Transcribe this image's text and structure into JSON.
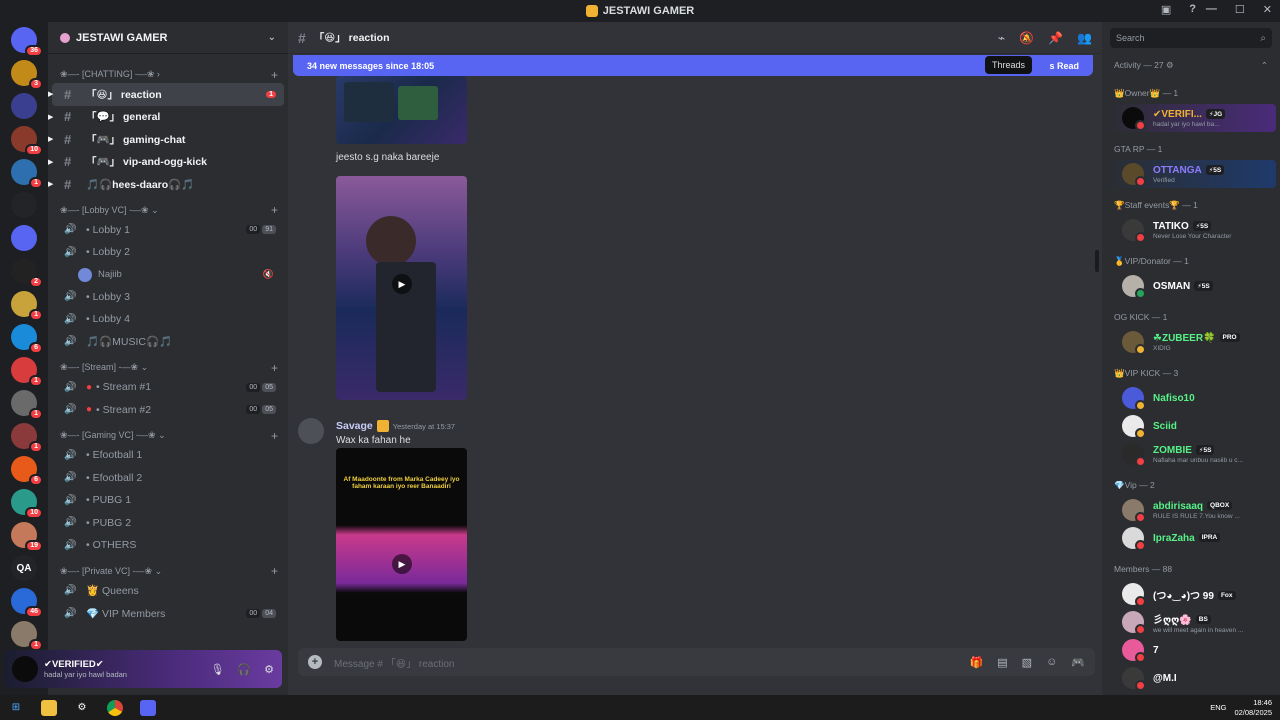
{
  "window": {
    "title": "JESTAWI GAMER"
  },
  "rail": {
    "servers": [
      {
        "label": "",
        "badge": "36",
        "color": "#5865f2"
      },
      {
        "label": "",
        "badge": "3",
        "color": "#c28a18"
      },
      {
        "label": "",
        "badge": "",
        "color": "#3b3f8f"
      },
      {
        "label": "",
        "badge": "10",
        "color": "#8a3a2a"
      },
      {
        "label": "",
        "badge": "1",
        "color": "#2e6fb0"
      },
      {
        "label": "",
        "badge": "",
        "color": "#232428"
      },
      {
        "label": "",
        "badge": "",
        "color": "#5865f2"
      },
      {
        "label": "",
        "badge": "2",
        "color": "#222"
      },
      {
        "label": "",
        "badge": "1",
        "color": "#c8a23a"
      },
      {
        "label": "",
        "badge": "6",
        "color": "#1a8bd8"
      },
      {
        "label": "",
        "badge": "1",
        "color": "#d83c3c"
      },
      {
        "label": "",
        "badge": "1",
        "color": "#6a6a6a"
      },
      {
        "label": "",
        "badge": "1",
        "color": "#8a3a3a"
      },
      {
        "label": "",
        "badge": "6",
        "color": "#e85a1a"
      },
      {
        "label": "",
        "badge": "10",
        "color": "#2a9a8a"
      },
      {
        "label": "",
        "badge": "19",
        "color": "#c47a5a"
      },
      {
        "label": "QA",
        "badge": "",
        "color": "#232428"
      },
      {
        "label": "",
        "badge": "46",
        "color": "#2a6ad8"
      },
      {
        "label": "",
        "badge": "1",
        "color": "#8a7a6a"
      }
    ],
    "new_label": "NEW"
  },
  "sidebar": {
    "guild_name": "JESTAWI GAMER",
    "categories": [
      {
        "name": "❀—- [CHATTING] -—❀ ›",
        "channels": [
          {
            "type": "text",
            "name": "「😆」 reaction",
            "state": "active",
            "badge": "1"
          },
          {
            "type": "text",
            "name": "「💬」 general",
            "state": "unread"
          },
          {
            "type": "text",
            "name": "「🎮」 gaming-chat",
            "state": "unread"
          },
          {
            "type": "text",
            "name": "「🎮」 vip-and-ogg-kick",
            "state": "unread"
          },
          {
            "type": "text",
            "name": "🎵🎧hees-daaro🎧🎵",
            "state": "unread"
          }
        ]
      },
      {
        "name": "❀—- [Lobby VC] -—❀ ⌄",
        "channels": [
          {
            "type": "voice",
            "name": "• Lobby 1",
            "counts": [
              "00",
              "91"
            ]
          },
          {
            "type": "voice",
            "name": "• Lobby 2",
            "users": [
              {
                "name": "Najiib"
              }
            ]
          },
          {
            "type": "voice",
            "name": "• Lobby 3"
          },
          {
            "type": "voice",
            "name": "• Lobby 4"
          },
          {
            "type": "voice",
            "name": "🎵🎧MUSIC🎧🎵"
          }
        ]
      },
      {
        "name": "❀—- [Stream] -—❀ ⌄",
        "channels": [
          {
            "type": "voice",
            "name": "• Stream #1",
            "dot": true,
            "counts": [
              "00",
              "05"
            ]
          },
          {
            "type": "voice",
            "name": "• Stream #2",
            "dot": true,
            "counts": [
              "00",
              "05"
            ]
          }
        ]
      },
      {
        "name": "❀—- [Gaming VC] -—❀ ⌄",
        "channels": [
          {
            "type": "voice",
            "name": "• Efootball 1"
          },
          {
            "type": "voice",
            "name": "• Efootball 2"
          },
          {
            "type": "voice",
            "name": "• PUBG 1"
          },
          {
            "type": "voice",
            "name": "• PUBG 2"
          },
          {
            "type": "voice",
            "name": "• OTHERS"
          }
        ]
      },
      {
        "name": "❀—- [Private VC] -—❀ ⌄",
        "channels": [
          {
            "type": "voice",
            "name": "👸 Queens"
          },
          {
            "type": "voice",
            "name": "💎 VIP Members",
            "counts": [
              "00",
              "04"
            ]
          }
        ]
      }
    ]
  },
  "user_panel": {
    "name": "✔VERIFIED✔",
    "status": "hadal yar iyo hawl badan"
  },
  "channel": {
    "name": "「😆」 reaction",
    "new_messages": "34 new messages since 18:05",
    "mark_read": "s Read",
    "tooltip": "Threads",
    "composer_placeholder": "Message # 「😆」 reaction"
  },
  "messages": {
    "caption1": "jeesto s.g naka bareeje",
    "author": "Savage",
    "timestamp": "Yesterday at 15:37",
    "text": "Wax ka fahan he",
    "video2_text": "Af Maadoonte from Marka Cadeey iyo faham karaan iyo reer Banaadiri"
  },
  "members": {
    "search_placeholder": "Search",
    "activity": "Activity — 27 ⚙",
    "groups": [
      {
        "name": "👑Owner👑 — 1",
        "members": [
          {
            "name": "✔VERIFI...",
            "tag": "⚡JG",
            "sub": "hadal yar iyo hawl ba...",
            "color": "#f0b232",
            "style": "hl2",
            "av": "#0b0b0b"
          }
        ]
      },
      {
        "name": "GTA RP — 1",
        "members": [
          {
            "name": "OTTANGA",
            "tag": "⚡5S",
            "sub": "Verified",
            "color": "#8e7cff",
            "style": "hl",
            "av": "#5a4a2a"
          }
        ]
      },
      {
        "name": "🏆Staff events🏆 — 1",
        "members": [
          {
            "name": "TATIKO",
            "tag": "⚡5S",
            "sub": "Never Lose Your Character",
            "color": "#ffffff",
            "av": "#3a3a3a"
          }
        ]
      },
      {
        "name": "🥇VIP/Donator — 1",
        "members": [
          {
            "name": "OSMAN",
            "tag": "⚡5S",
            "sub": "",
            "color": "#ffffff",
            "av": "#b5b0a8",
            "sc": "#23a55a"
          }
        ]
      },
      {
        "name": "OG KICK — 1",
        "members": [
          {
            "name": "☘ZUBEER🍀",
            "tag": "PRO",
            "sub": "XIDIG",
            "color": "#57f287",
            "av": "#6a5a3a",
            "sc": "#f0b232"
          }
        ]
      },
      {
        "name": "👑VIP KICK — 3",
        "members": [
          {
            "name": "Nafiso10",
            "tag": "",
            "sub": "",
            "color": "#57f287",
            "av": "#4a5ad8",
            "sc": "#f0b232"
          },
          {
            "name": "Sciid",
            "tag": "",
            "sub": "",
            "color": "#57f287",
            "av": "#eaeaea",
            "sc": "#f0b232"
          },
          {
            "name": "ZOMBIE",
            "tag": "⚡5S",
            "sub": "Naflaha mar unbuu nasiib u c...",
            "color": "#57f287",
            "av": "#2a2a2a"
          }
        ]
      },
      {
        "name": "💎Vip — 2",
        "members": [
          {
            "name": "abdirisaaq",
            "tag": "QBOX",
            "sub": "RULE IS RULE 7.You know ...",
            "color": "#57f287",
            "av": "#8a7a6a"
          },
          {
            "name": "IpraZaha",
            "tag": "IPRA",
            "sub": "",
            "color": "#57f287",
            "av": "#dadada"
          }
        ]
      },
      {
        "name": "Members — 88",
        "members": [
          {
            "name": "(つ◕‿◕)つ 99",
            "tag": "Fox",
            "sub": "",
            "color": "#ffffff",
            "av": "#eaeaea"
          },
          {
            "name": "彡ღღ🌸",
            "tag": "BS",
            "sub": "we will meet again in heaven ...",
            "color": "#ffffff",
            "av": "#c8a8b8"
          },
          {
            "name": "7",
            "tag": "",
            "sub": "",
            "color": "#ffffff",
            "av": "#e85a9a"
          },
          {
            "name": "@M.I",
            "tag": "",
            "sub": "",
            "color": "#ffffff",
            "av": "#3a3a3a"
          }
        ]
      }
    ]
  },
  "taskbar": {
    "time": "18:46",
    "date": "02/08/2025",
    "lang": "ENG"
  }
}
